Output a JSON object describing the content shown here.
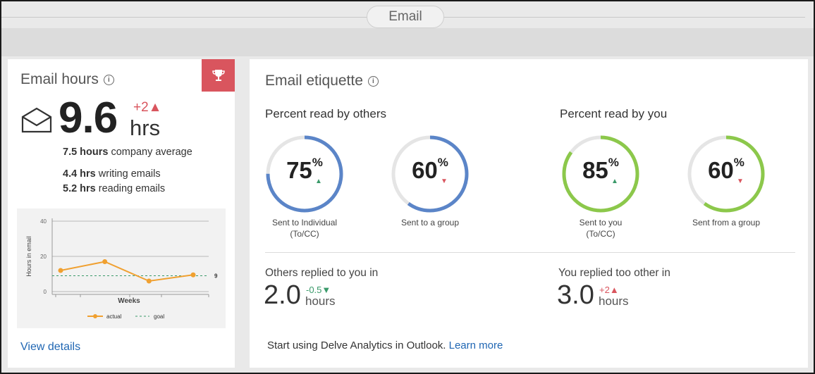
{
  "header": {
    "title": "Email"
  },
  "email_hours": {
    "title": "Email hours",
    "info_icon": "info-icon",
    "trophy_icon": "trophy-icon",
    "value": "9.6",
    "unit": "hrs",
    "delta": "+2▲",
    "company_avg_value": "7.5 hours",
    "company_avg_text": " company average",
    "writing_value": "4.4 hrs",
    "writing_text": " writing emails",
    "reading_value": "5.2 hrs",
    "reading_text": " reading emails",
    "view_details": "View details",
    "colors": {
      "accent": "#1f66b3",
      "trophy_bg": "#d9555e",
      "actual": "#f0a030",
      "goal": "#3a9a6a"
    }
  },
  "chart_data": {
    "type": "line",
    "x": [
      1,
      2,
      3,
      4
    ],
    "series": [
      {
        "name": "actual",
        "values": [
          12,
          17,
          6,
          9.5
        ]
      },
      {
        "name": "goal",
        "values": [
          9,
          9,
          9,
          9
        ]
      }
    ],
    "ylabel": "Hours in email",
    "xlabel": "Weeks",
    "ylim": [
      0,
      40
    ],
    "yticks": [
      "0",
      "20",
      "40"
    ],
    "goal_label": "9",
    "legend": [
      "actual",
      "goal"
    ],
    "grid": true
  },
  "etiquette": {
    "title": "Email etiquette",
    "read_by_others": {
      "title": "Percent read by others",
      "items": [
        {
          "value": "75",
          "pct": "%",
          "arrow": "▲",
          "trend": "up",
          "fraction": 0.75,
          "color": "#5b85c8",
          "label1": "Sent to Individual",
          "label2": "(To/CC)"
        },
        {
          "value": "60",
          "pct": "%",
          "arrow": "▼",
          "trend": "down",
          "fraction": 0.6,
          "color": "#5b85c8",
          "label1": "Sent to a group",
          "label2": ""
        }
      ]
    },
    "read_by_you": {
      "title": "Percent read by you",
      "items": [
        {
          "value": "85",
          "pct": "%",
          "arrow": "▲",
          "trend": "up",
          "fraction": 0.85,
          "color": "#8cc84b",
          "label1": "Sent to you",
          "label2": "(To/CC)"
        },
        {
          "value": "60",
          "pct": "%",
          "arrow": "▼",
          "trend": "down",
          "fraction": 0.6,
          "color": "#8cc84b",
          "label1": "Sent from a group",
          "label2": ""
        }
      ]
    },
    "others_replied": {
      "label": "Others replied to you in",
      "value": "2.0",
      "delta": "-0.5▼",
      "unit": "hours"
    },
    "you_replied": {
      "label": "You replied too other in",
      "value": "3.0",
      "delta": "+2▲",
      "unit": "hours"
    },
    "footer_text": "Start using Delve Analytics in Outlook. ",
    "footer_link": "Learn more"
  }
}
